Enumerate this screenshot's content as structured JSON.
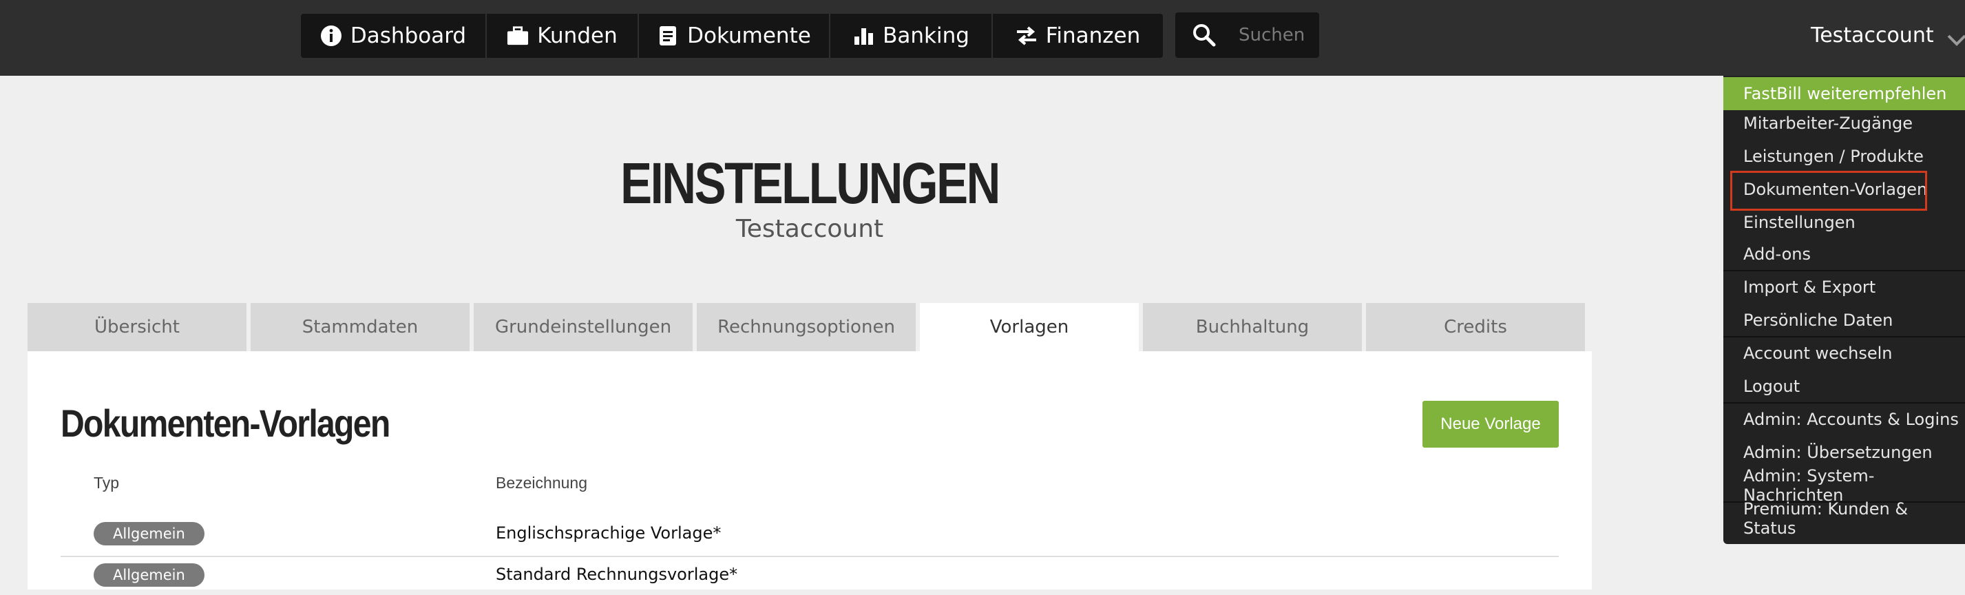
{
  "nav": {
    "items": [
      {
        "label": "Dashboard",
        "icon": "info-icon"
      },
      {
        "label": "Kunden",
        "icon": "briefcase-icon"
      },
      {
        "label": "Dokumente",
        "icon": "document-icon"
      },
      {
        "label": "Banking",
        "icon": "bar-chart-icon"
      },
      {
        "label": "Finanzen",
        "icon": "transfer-arrows-icon"
      }
    ],
    "search_placeholder": "Suchen",
    "account_label": "Testaccount"
  },
  "dropdown": {
    "items": [
      {
        "label": "FastBill weiterempfehlen"
      },
      {
        "label": "Mitarbeiter-Zugänge"
      },
      {
        "label": "Leistungen / Produkte"
      },
      {
        "label": "Dokumenten-Vorlagen"
      },
      {
        "label": "Einstellungen"
      },
      {
        "label": "Add-ons"
      },
      {
        "label": "Import & Export"
      },
      {
        "label": "Persönliche Daten"
      },
      {
        "label": "Account wechseln"
      },
      {
        "label": "Logout"
      },
      {
        "label": "Admin: Accounts & Logins"
      },
      {
        "label": "Admin: Übersetzungen"
      },
      {
        "label": "Admin: System-Nachrichten"
      },
      {
        "label": "Premium: Kunden & Status"
      }
    ]
  },
  "header": {
    "title": "EINSTELLUNGEN",
    "subtitle": "Testaccount"
  },
  "tabs": [
    {
      "label": "Übersicht"
    },
    {
      "label": "Stammdaten"
    },
    {
      "label": "Grundeinstellungen"
    },
    {
      "label": "Rechnungsoptionen"
    },
    {
      "label": "Vorlagen"
    },
    {
      "label": "Buchhaltung"
    },
    {
      "label": "Credits"
    }
  ],
  "panel": {
    "title": "Dokumenten-Vorlagen",
    "new_button": "Neue Vorlage",
    "columns": {
      "type": "Typ",
      "name": "Bezeichnung"
    },
    "rows": [
      {
        "type": "Allgemein",
        "name": "Englischsprachige Vorlage*"
      },
      {
        "type": "Allgemein",
        "name": "Standard Rechnungsvorlage*"
      }
    ]
  },
  "colors": {
    "accent": "#7fb33b",
    "topbar": "#2f2f2f",
    "highlight_box": "#d23a1e"
  }
}
